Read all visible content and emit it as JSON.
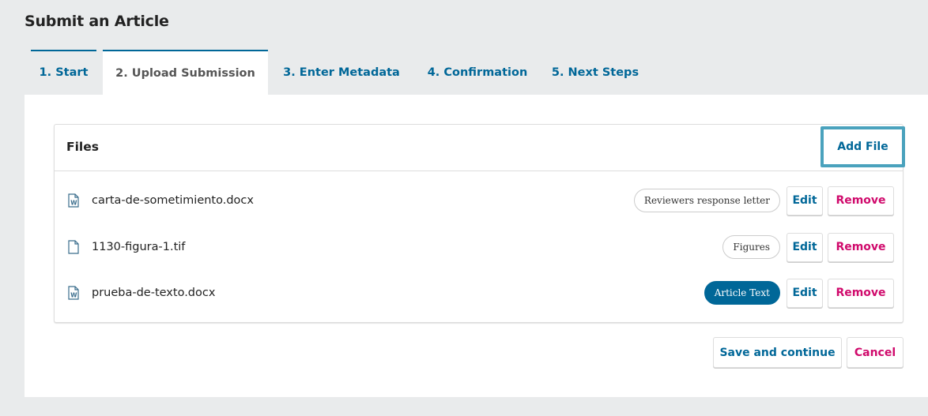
{
  "page": {
    "title": "Submit an Article"
  },
  "tabs": [
    {
      "label": "1. Start"
    },
    {
      "label": "2. Upload Submission"
    },
    {
      "label": "3. Enter Metadata"
    },
    {
      "label": "4. Confirmation"
    },
    {
      "label": "5. Next Steps"
    }
  ],
  "files_panel": {
    "title": "Files",
    "add_file_label": "Add File",
    "files": [
      {
        "name": "carta-de-sometimiento.docx",
        "icon": "word-document-icon",
        "genre": "Reviewers response letter",
        "edit_label": "Edit",
        "remove_label": "Remove"
      },
      {
        "name": "1130-figura-1.tif",
        "icon": "file-icon",
        "genre": "Figures",
        "edit_label": "Edit",
        "remove_label": "Remove"
      },
      {
        "name": "prueba-de-texto.docx",
        "icon": "word-document-icon",
        "genre": "Article Text",
        "edit_label": "Edit",
        "remove_label": "Remove"
      }
    ]
  },
  "actions": {
    "save_label": "Save and continue",
    "cancel_label": "Cancel"
  },
  "colors": {
    "primary": "#006798",
    "danger": "#d00a6c",
    "highlight": "#4aa2bd",
    "background": "#e9ebec"
  }
}
